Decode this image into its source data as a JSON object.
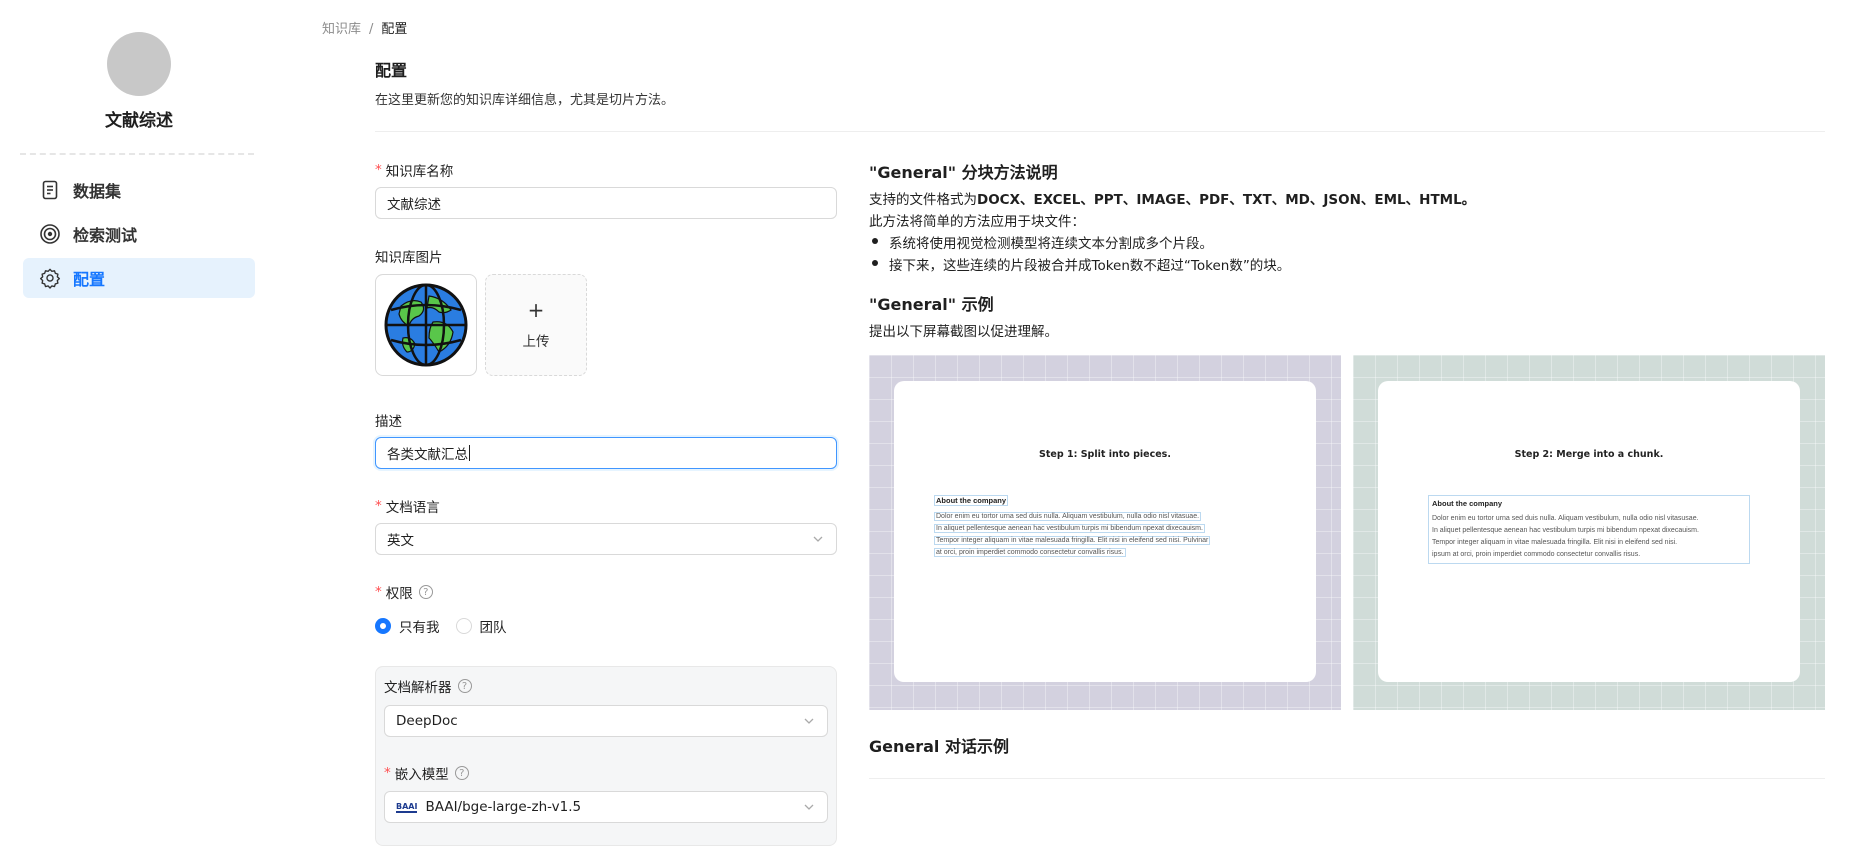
{
  "sidebar": {
    "kb_name": "文献综述",
    "items": [
      {
        "label": "数据集",
        "icon": "document-icon"
      },
      {
        "label": "检索测试",
        "icon": "target-icon"
      },
      {
        "label": "配置",
        "icon": "gear-icon"
      }
    ],
    "active_index": 2
  },
  "breadcrumb": {
    "parent": "知识库",
    "separator": "/",
    "current": "配置"
  },
  "header": {
    "title": "配置",
    "subtitle": "在这里更新您的知识库详细信息，尤其是切片方法。"
  },
  "form": {
    "name_label": "知识库名称",
    "name_value": "文献综述",
    "image_label": "知识库图片",
    "upload_plus": "+",
    "upload_label": "上传",
    "desc_label": "描述",
    "desc_value": "各类文献汇总",
    "lang_label": "文档语言",
    "lang_value": "英文",
    "perm_label": "权限",
    "perm_options": [
      "只有我",
      "团队"
    ],
    "perm_selected": "只有我",
    "parser_label": "文档解析器",
    "parser_value": "DeepDoc",
    "embed_label": "嵌入模型",
    "embed_value": "BAAI/bge-large-zh-v1.5",
    "embed_logo_text": "BAAI"
  },
  "info": {
    "method_title": "\"General\" 分块方法说明",
    "formats_prefix": "支持的文件格式为",
    "formats": "DOCX、EXCEL、PPT、IMAGE、PDF、TXT、MD、JSON、EML、HTML。",
    "method_intro": "此方法将简单的方法应用于块文件：",
    "bullets": [
      "系统将使用视觉检测模型将连续文本分割成多个片段。",
      "接下来，这些连续的片段被合并成Token数不超过“Token数”的块。"
    ],
    "example_title": "\"General\" 示例",
    "example_sub": "提出以下屏幕截图以促进理解。",
    "step1": "Step 1: Split into pieces.",
    "step2": "Step 2: Merge into a chunk.",
    "doc_heading": "About the company",
    "doc_lines": [
      "Dolor enim eu tortor urna sed duis nulla. Aliquam vestibulum, nulla odio nisl vitasuae.",
      "In aliquet pellentesque aenean hac vestibulum turpis mi bibendum npexat dixecauism.",
      "Tempor integer aliquam in vitae malesuada fringilla. Elit nisi in eleifend sed nisi. Pulvinar",
      "at orci, proin imperdiet commodo consectetur convallis risus."
    ],
    "doc_lines_merged": [
      "Dolor enim eu tortor urna sed duis nulla. Aliquam vestibulum, nulla odio nisl vitasusae.",
      "In aliquet pellentesque aenean hac vestibulum turpis mi bibendum npexat dixecauism.",
      "Tempor integer aliquam in vitae malesuada fringilla. Elit nisi in eleifend sed nisi.",
      "ipsum at orci, proin imperdiet commodo consectetur convallis risus."
    ],
    "dialog_title": "General 对话示例"
  },
  "colors": {
    "accent": "#1677ff",
    "panel1_bg": "#d3d1df",
    "panel2_bg": "#d0dcd8",
    "active_nav_bg": "#e6f2fd",
    "required": "#ff4d4f"
  }
}
